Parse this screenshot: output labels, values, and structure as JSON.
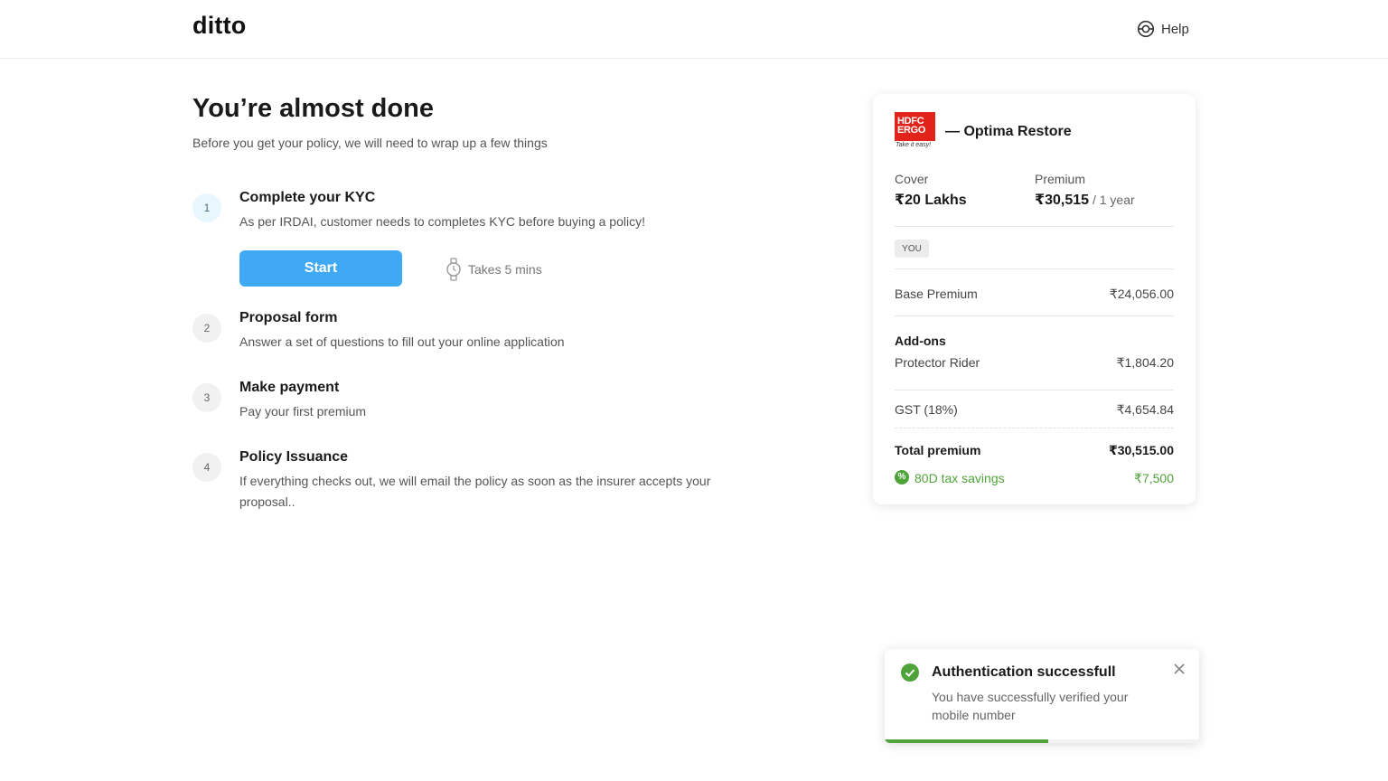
{
  "header": {
    "logo": "ditto",
    "help_label": "Help",
    "help_icon": "lifebuoy-icon"
  },
  "main": {
    "title": "You’re almost done",
    "subtitle": "Before you get your policy, we will need to wrap up a few things",
    "steps": [
      {
        "num": "1",
        "title": "Complete your KYC",
        "desc": "As per IRDAI, customer needs to completes KYC before buying a policy!"
      },
      {
        "num": "2",
        "title": "Proposal form",
        "desc": "Answer a set of questions to fill out your online application"
      },
      {
        "num": "3",
        "title": "Make payment",
        "desc": "Pay your first premium"
      },
      {
        "num": "4",
        "title": "Policy Issuance",
        "desc": "If everything checks out, we will email the policy as soon as the insurer accepts your proposal.."
      }
    ],
    "start_label": "Start",
    "takes_label": "Takes 5 mins",
    "accent_color": "#3fa9f5"
  },
  "card": {
    "insurer_logo_text": "HDFC ERGO",
    "insurer_logo_tagline": "Take it easy!",
    "plan_name": "— Optima Restore",
    "cover_label": "Cover",
    "cover_value": "₹20 Lakhs",
    "premium_label": "Premium",
    "premium_value": "₹30,515",
    "premium_period": " / 1 year",
    "you_badge": "YOU",
    "base_premium_label": "Base Premium",
    "base_premium_value": "₹24,056.00",
    "addons_heading": "Add-ons",
    "addon_label": "Protector Rider",
    "addon_value": "₹1,804.20",
    "gst_label": "GST (18%)",
    "gst_value": "₹4,654.84",
    "total_label": "Total premium",
    "total_value": "₹30,515.00",
    "tax_label": "80D tax savings",
    "tax_value": "₹7,500",
    "tax_icon_glyph": "%",
    "brand_red": "#e2231a",
    "savings_green": "#4fa33a"
  },
  "toast": {
    "title": "Authentication successfull",
    "message": "You have successfully verified your mobile number",
    "progress_percent": 52,
    "status_color": "#4fa33a"
  }
}
